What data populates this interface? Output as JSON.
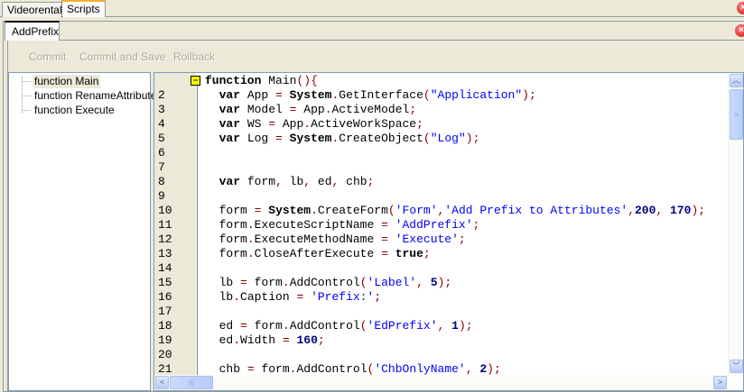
{
  "top_tabs": [
    {
      "label": "Videorental"
    },
    {
      "label": "Scripts"
    }
  ],
  "inner_tab": {
    "label": "AddPrefix"
  },
  "toolbar": {
    "commit": "Commit",
    "commit_save": "Commit and Save",
    "rollback": "Rollback"
  },
  "tree": [
    {
      "label": "function Main"
    },
    {
      "label": "function RenameAttribute"
    },
    {
      "label": "function Execute"
    }
  ],
  "editor": {
    "keywords": [
      "function",
      "var",
      "true",
      "System"
    ],
    "lines": [
      "function Main(){",
      "  var App = System.GetInterface(\"Application\");",
      "  var Model = App.ActiveModel;",
      "  var WS = App.ActiveWorkSpace;",
      "  var Log = System.CreateObject(\"Log\");",
      "",
      "",
      "  var form, lb, ed, chb;",
      "",
      "  form = System.CreateForm('Form','Add Prefix to Attributes',200, 170);",
      "  form.ExecuteScriptName = 'AddPrefix';",
      "  form.ExecuteMethodName = 'Execute';",
      "  form.CloseAfterExecute = true;",
      "",
      "  lb = form.AddControl('Label', 5);",
      "  lb.Caption = 'Prefix:';",
      "",
      "  ed = form.AddControl('EdPrefix', 1);",
      "  ed.Width = 160;",
      "",
      "  chb = form.AddControl('ChbOnlyName', 2);"
    ]
  }
}
